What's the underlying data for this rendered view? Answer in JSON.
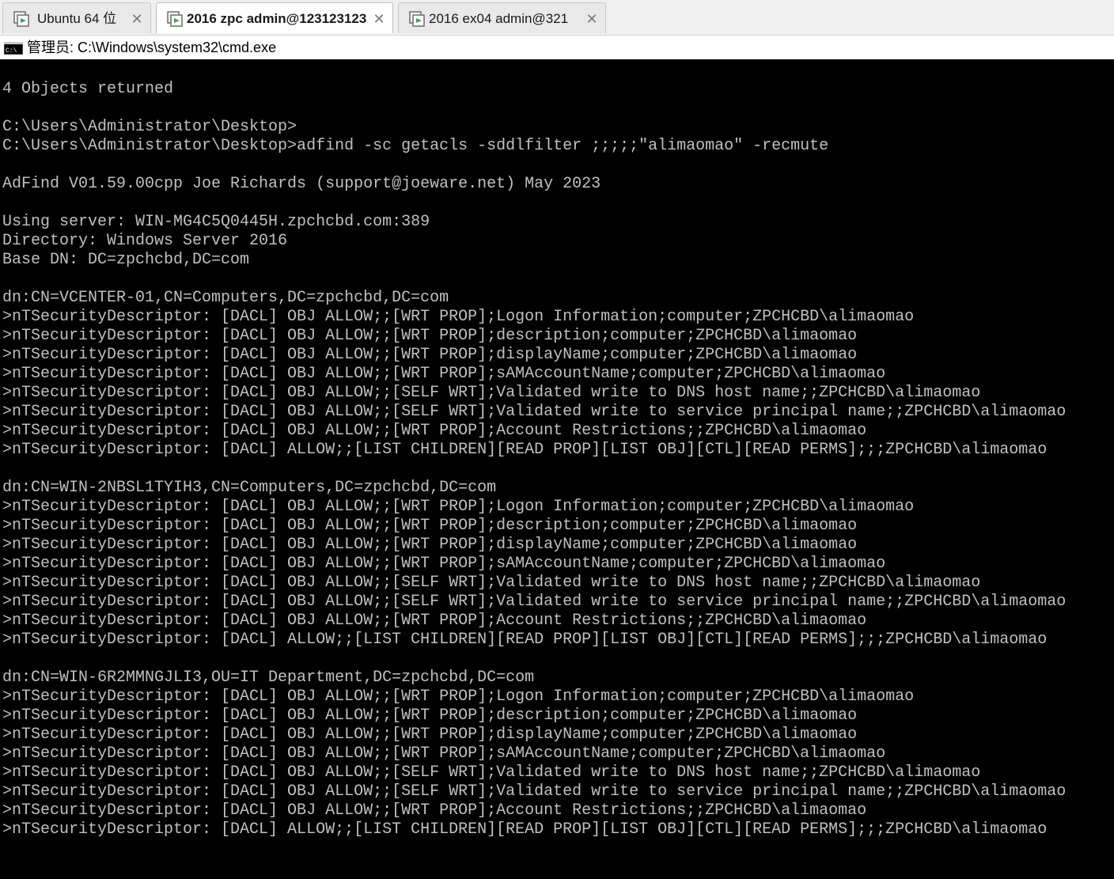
{
  "tabs": [
    {
      "label": "Ubuntu 64 位",
      "active": false,
      "close": "✕"
    },
    {
      "label": "2016 zpc admin@123123123",
      "active": true,
      "close": "✕"
    },
    {
      "label": "2016 ex04 admin@321",
      "active": false,
      "close": "✕"
    }
  ],
  "window": {
    "title": "管理员: C:\\Windows\\system32\\cmd.exe",
    "icon": "cmd-icon"
  },
  "console": {
    "lines": [
      "",
      "4 Objects returned",
      "",
      "C:\\Users\\Administrator\\Desktop>",
      "C:\\Users\\Administrator\\Desktop>adfind -sc getacls -sddlfilter ;;;;;\"alimaomao\" -recmute",
      "",
      "AdFind V01.59.00cpp Joe Richards (support@joeware.net) May 2023",
      "",
      "Using server: WIN-MG4C5Q0445H.zpchcbd.com:389",
      "Directory: Windows Server 2016",
      "Base DN: DC=zpchcbd,DC=com",
      "",
      "dn:CN=VCENTER-01,CN=Computers,DC=zpchcbd,DC=com",
      ">nTSecurityDescriptor: [DACL] OBJ ALLOW;;[WRT PROP];Logon Information;computer;ZPCHCBD\\alimaomao",
      ">nTSecurityDescriptor: [DACL] OBJ ALLOW;;[WRT PROP];description;computer;ZPCHCBD\\alimaomao",
      ">nTSecurityDescriptor: [DACL] OBJ ALLOW;;[WRT PROP];displayName;computer;ZPCHCBD\\alimaomao",
      ">nTSecurityDescriptor: [DACL] OBJ ALLOW;;[WRT PROP];sAMAccountName;computer;ZPCHCBD\\alimaomao",
      ">nTSecurityDescriptor: [DACL] OBJ ALLOW;;[SELF WRT];Validated write to DNS host name;;ZPCHCBD\\alimaomao",
      ">nTSecurityDescriptor: [DACL] OBJ ALLOW;;[SELF WRT];Validated write to service principal name;;ZPCHCBD\\alimaomao",
      ">nTSecurityDescriptor: [DACL] OBJ ALLOW;;[WRT PROP];Account Restrictions;;ZPCHCBD\\alimaomao",
      ">nTSecurityDescriptor: [DACL] ALLOW;;[LIST CHILDREN][READ PROP][LIST OBJ][CTL][READ PERMS];;;ZPCHCBD\\alimaomao",
      "",
      "dn:CN=WIN-2NBSL1TYIH3,CN=Computers,DC=zpchcbd,DC=com",
      ">nTSecurityDescriptor: [DACL] OBJ ALLOW;;[WRT PROP];Logon Information;computer;ZPCHCBD\\alimaomao",
      ">nTSecurityDescriptor: [DACL] OBJ ALLOW;;[WRT PROP];description;computer;ZPCHCBD\\alimaomao",
      ">nTSecurityDescriptor: [DACL] OBJ ALLOW;;[WRT PROP];displayName;computer;ZPCHCBD\\alimaomao",
      ">nTSecurityDescriptor: [DACL] OBJ ALLOW;;[WRT PROP];sAMAccountName;computer;ZPCHCBD\\alimaomao",
      ">nTSecurityDescriptor: [DACL] OBJ ALLOW;;[SELF WRT];Validated write to DNS host name;;ZPCHCBD\\alimaomao",
      ">nTSecurityDescriptor: [DACL] OBJ ALLOW;;[SELF WRT];Validated write to service principal name;;ZPCHCBD\\alimaomao",
      ">nTSecurityDescriptor: [DACL] OBJ ALLOW;;[WRT PROP];Account Restrictions;;ZPCHCBD\\alimaomao",
      ">nTSecurityDescriptor: [DACL] ALLOW;;[LIST CHILDREN][READ PROP][LIST OBJ][CTL][READ PERMS];;;ZPCHCBD\\alimaomao",
      "",
      "dn:CN=WIN-6R2MMNGJLI3,OU=IT Department,DC=zpchcbd,DC=com",
      ">nTSecurityDescriptor: [DACL] OBJ ALLOW;;[WRT PROP];Logon Information;computer;ZPCHCBD\\alimaomao",
      ">nTSecurityDescriptor: [DACL] OBJ ALLOW;;[WRT PROP];description;computer;ZPCHCBD\\alimaomao",
      ">nTSecurityDescriptor: [DACL] OBJ ALLOW;;[WRT PROP];displayName;computer;ZPCHCBD\\alimaomao",
      ">nTSecurityDescriptor: [DACL] OBJ ALLOW;;[WRT PROP];sAMAccountName;computer;ZPCHCBD\\alimaomao",
      ">nTSecurityDescriptor: [DACL] OBJ ALLOW;;[SELF WRT];Validated write to DNS host name;;ZPCHCBD\\alimaomao",
      ">nTSecurityDescriptor: [DACL] OBJ ALLOW;;[SELF WRT];Validated write to service principal name;;ZPCHCBD\\alimaomao",
      ">nTSecurityDescriptor: [DACL] OBJ ALLOW;;[WRT PROP];Account Restrictions;;ZPCHCBD\\alimaomao",
      ">nTSecurityDescriptor: [DACL] ALLOW;;[LIST CHILDREN][READ PROP][LIST OBJ][CTL][READ PERMS];;;ZPCHCBD\\alimaomao"
    ]
  },
  "colors": {
    "console_background": "#000000",
    "console_text": "#c0c0c0",
    "tab_strip": "#f0f0f0",
    "active_tab": "#ffffff",
    "inactive_tab": "#e9e9e9"
  }
}
